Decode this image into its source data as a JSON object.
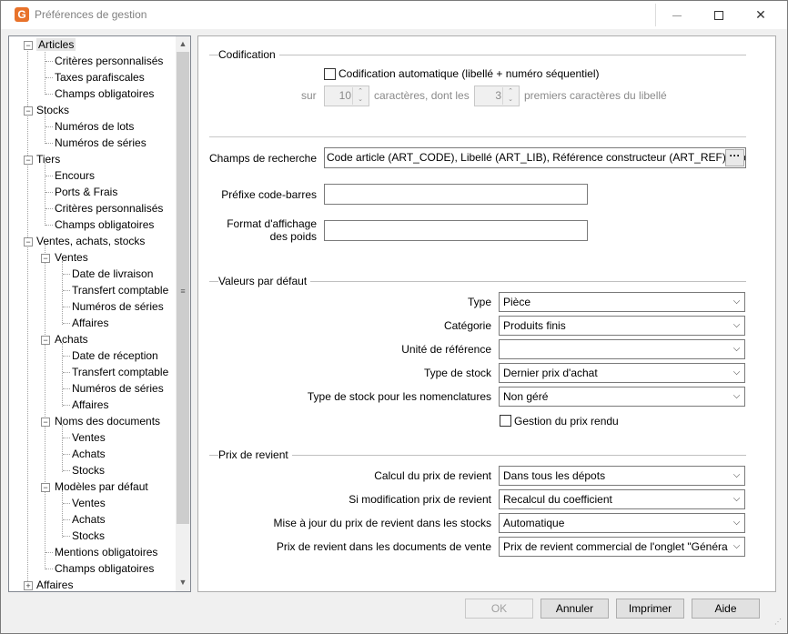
{
  "window": {
    "title": "Préférences de gestion",
    "minimize": "—",
    "maximize": "□",
    "close": "✕"
  },
  "tree": {
    "scroll_up": "▲",
    "scroll_down": "▼",
    "scroll_grip": "≡",
    "nodes": [
      "Articles",
      "Critères personnalisés",
      "Taxes parafiscales",
      "Champs obligatoires",
      "Stocks",
      "Numéros de lots",
      "Numéros de séries",
      "Tiers",
      "Encours",
      "Ports & Frais",
      "Critères personnalisés",
      "Champs obligatoires",
      "Ventes, achats, stocks",
      "Ventes",
      "Date de livraison",
      "Transfert comptable",
      "Numéros de séries",
      "Affaires",
      "Achats",
      "Date de réception",
      "Transfert comptable",
      "Numéros de séries",
      "Affaires",
      "Noms des documents",
      "Ventes",
      "Achats",
      "Stocks",
      "Modèles par défaut",
      "Ventes",
      "Achats",
      "Stocks",
      "Mentions obligatoires",
      "Champs obligatoires",
      "Affaires"
    ]
  },
  "codification": {
    "title": "Codification",
    "auto_label": "Codification automatique (libellé + numéro séquentiel)",
    "auto_checked": false,
    "sur_label": "sur",
    "chars_value": "10",
    "chars_label": "caractères,  dont les",
    "first_value": "3",
    "first_label": "premiers caractères du libellé"
  },
  "search": {
    "fields_label": "Champs de recherche",
    "fields_value": "Code article (ART_CODE), Libellé (ART_LIB), Référence constructeur (ART_REF), Code",
    "ellipsis": "···",
    "barcode_label": "Préfixe code-barres",
    "barcode_value": "",
    "weight_label_1": "Format d'affichage",
    "weight_label_2": "des poids",
    "weight_value": ""
  },
  "defaults": {
    "title": "Valeurs par défaut",
    "rows": [
      {
        "label": "Type",
        "value": "Pièce"
      },
      {
        "label": "Catégorie",
        "value": "Produits finis"
      },
      {
        "label": "Unité de référence",
        "value": ""
      },
      {
        "label": "Type de stock",
        "value": "Dernier prix d'achat"
      },
      {
        "label": "Type de stock pour les nomenclatures",
        "value": "Non géré"
      }
    ],
    "rendered_price_label": "Gestion du prix rendu",
    "rendered_price_checked": false
  },
  "cost": {
    "title": "Prix de revient",
    "rows": [
      {
        "label": "Calcul du prix de revient",
        "value": "Dans tous les dépots"
      },
      {
        "label": "Si modification prix de revient",
        "value": "Recalcul du coefficient"
      },
      {
        "label": "Mise à jour du prix de revient dans les stocks",
        "value": "Automatique"
      },
      {
        "label": "Prix de revient dans les documents de vente",
        "value": "Prix de revient commercial de l'onglet \"Généra"
      }
    ]
  },
  "buttons": {
    "ok": "OK",
    "ok_enabled": false,
    "cancel": "Annuler",
    "print": "Imprimer",
    "help": "Aide"
  }
}
